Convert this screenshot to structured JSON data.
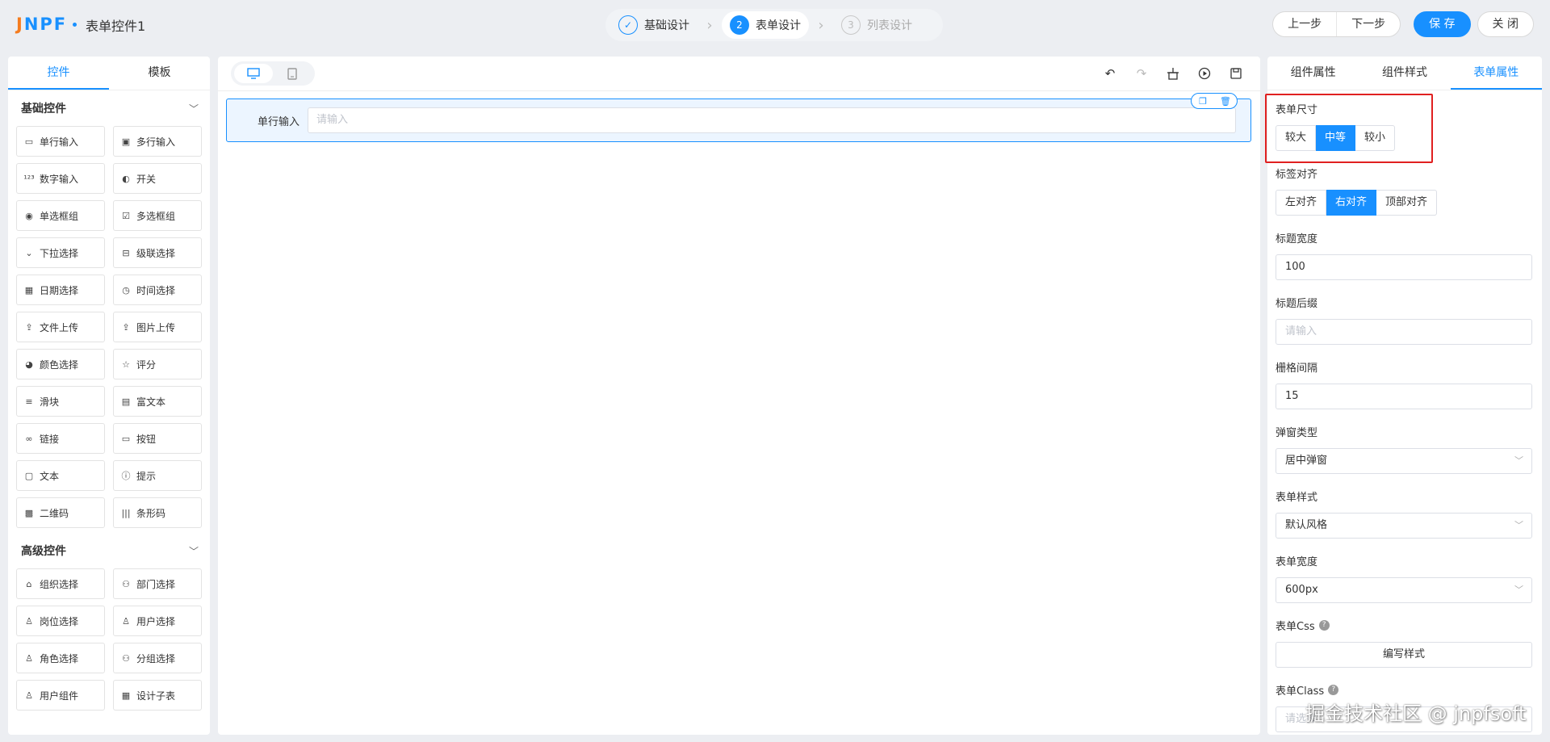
{
  "app": {
    "logo": "JNPF",
    "title": "表单控件1"
  },
  "steps": [
    {
      "num": "✓",
      "label": "基础设计",
      "state": "done"
    },
    {
      "num": "2",
      "label": "表单设计",
      "state": "current"
    },
    {
      "num": "3",
      "label": "列表设计",
      "state": "todo"
    }
  ],
  "actions": {
    "prev": "上一步",
    "next": "下一步",
    "save": "保 存",
    "close": "关 闭"
  },
  "left": {
    "tabs": [
      "控件",
      "模板"
    ],
    "groups": [
      {
        "title": "基础控件",
        "items": [
          {
            "icon": "input-icon",
            "label": "单行输入"
          },
          {
            "icon": "textarea-icon",
            "label": "多行输入"
          },
          {
            "icon": "number-icon",
            "label": "数字输入"
          },
          {
            "icon": "switch-icon",
            "label": "开关"
          },
          {
            "icon": "radio-icon",
            "label": "单选框组"
          },
          {
            "icon": "checkbox-icon",
            "label": "多选框组"
          },
          {
            "icon": "select-icon",
            "label": "下拉选择"
          },
          {
            "icon": "cascader-icon",
            "label": "级联选择"
          },
          {
            "icon": "date-icon",
            "label": "日期选择"
          },
          {
            "icon": "time-icon",
            "label": "时间选择"
          },
          {
            "icon": "upload-icon",
            "label": "文件上传"
          },
          {
            "icon": "image-upload-icon",
            "label": "图片上传"
          },
          {
            "icon": "palette-icon",
            "label": "颜色选择"
          },
          {
            "icon": "star-icon",
            "label": "评分"
          },
          {
            "icon": "slider-icon",
            "label": "滑块"
          },
          {
            "icon": "richtext-icon",
            "label": "富文本"
          },
          {
            "icon": "link-icon",
            "label": "链接"
          },
          {
            "icon": "button-icon",
            "label": "按钮"
          },
          {
            "icon": "text-icon",
            "label": "文本"
          },
          {
            "icon": "alert-icon",
            "label": "提示"
          },
          {
            "icon": "qrcode-icon",
            "label": "二维码"
          },
          {
            "icon": "barcode-icon",
            "label": "条形码"
          }
        ]
      },
      {
        "title": "高级控件",
        "items": [
          {
            "icon": "org-icon",
            "label": "组织选择"
          },
          {
            "icon": "dept-icon",
            "label": "部门选择"
          },
          {
            "icon": "position-icon",
            "label": "岗位选择"
          },
          {
            "icon": "user-icon",
            "label": "用户选择"
          },
          {
            "icon": "role-icon",
            "label": "角色选择"
          },
          {
            "icon": "group-icon",
            "label": "分组选择"
          },
          {
            "icon": "user-component-icon",
            "label": "用户组件"
          },
          {
            "icon": "table-icon",
            "label": "设计子表"
          }
        ]
      }
    ]
  },
  "canvas": {
    "field": {
      "label": "单行输入",
      "placeholder": "请输入"
    }
  },
  "right": {
    "tabs": [
      "组件属性",
      "组件样式",
      "表单属性"
    ],
    "form_size": {
      "label": "表单尺寸",
      "options": [
        "较大",
        "中等",
        "较小"
      ],
      "selected": "中等"
    },
    "label_align": {
      "label": "标签对齐",
      "options": [
        "左对齐",
        "右对齐",
        "顶部对齐"
      ],
      "selected": "右对齐"
    },
    "title_width": {
      "label": "标题宽度",
      "value": "100"
    },
    "title_suffix": {
      "label": "标题后缀",
      "placeholder": "请输入"
    },
    "grid_gap": {
      "label": "栅格间隔",
      "value": "15"
    },
    "popup_type": {
      "label": "弹窗类型",
      "value": "居中弹窗"
    },
    "form_style": {
      "label": "表单样式",
      "value": "默认风格"
    },
    "form_width": {
      "label": "表单宽度",
      "value": "600px"
    },
    "form_css": {
      "label": "表单Css",
      "button": "编写样式"
    },
    "form_class": {
      "label": "表单Class",
      "placeholder": "请选择"
    }
  },
  "watermark": "掘金技术社区 @ jnpfsoft",
  "colors": {
    "primary": "#1890ff",
    "highlight": "#e02020",
    "logo_orange": "#f57c1f"
  }
}
